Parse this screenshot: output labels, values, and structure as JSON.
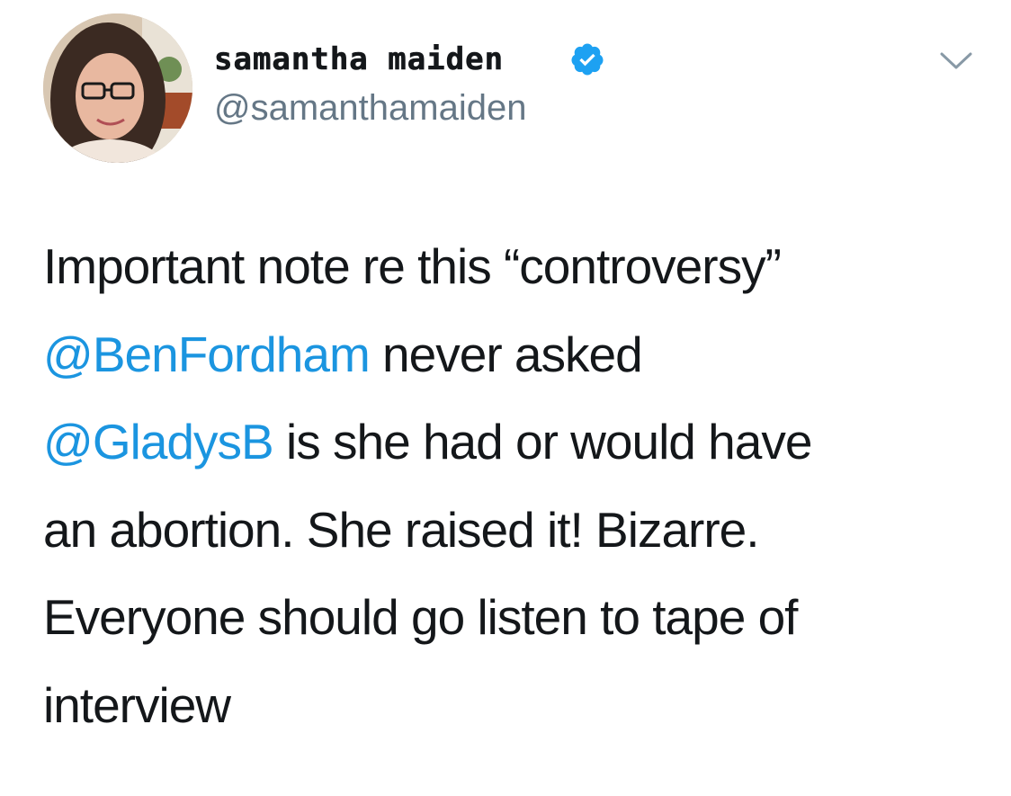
{
  "author": {
    "display_name": "samantha maiden",
    "handle": "@samanthamaiden",
    "verified": true
  },
  "icons": {
    "verified": "verified-badge-icon",
    "menu": "chevron-down-icon"
  },
  "colors": {
    "mention": "#1b95e0",
    "verified": "#1da1f2",
    "handle": "#657786",
    "text": "#14171a"
  },
  "tweet": {
    "line1": "Important note re this “controversy”",
    "mention1": "@BenFordham",
    "line2_rest": " never asked",
    "mention2": "@GladysB",
    "line3_rest": " is she had or would have",
    "line4": "an abortion. She raised it! Bizarre.",
    "line5": "Everyone should go listen to tape of",
    "line6": "interview"
  }
}
